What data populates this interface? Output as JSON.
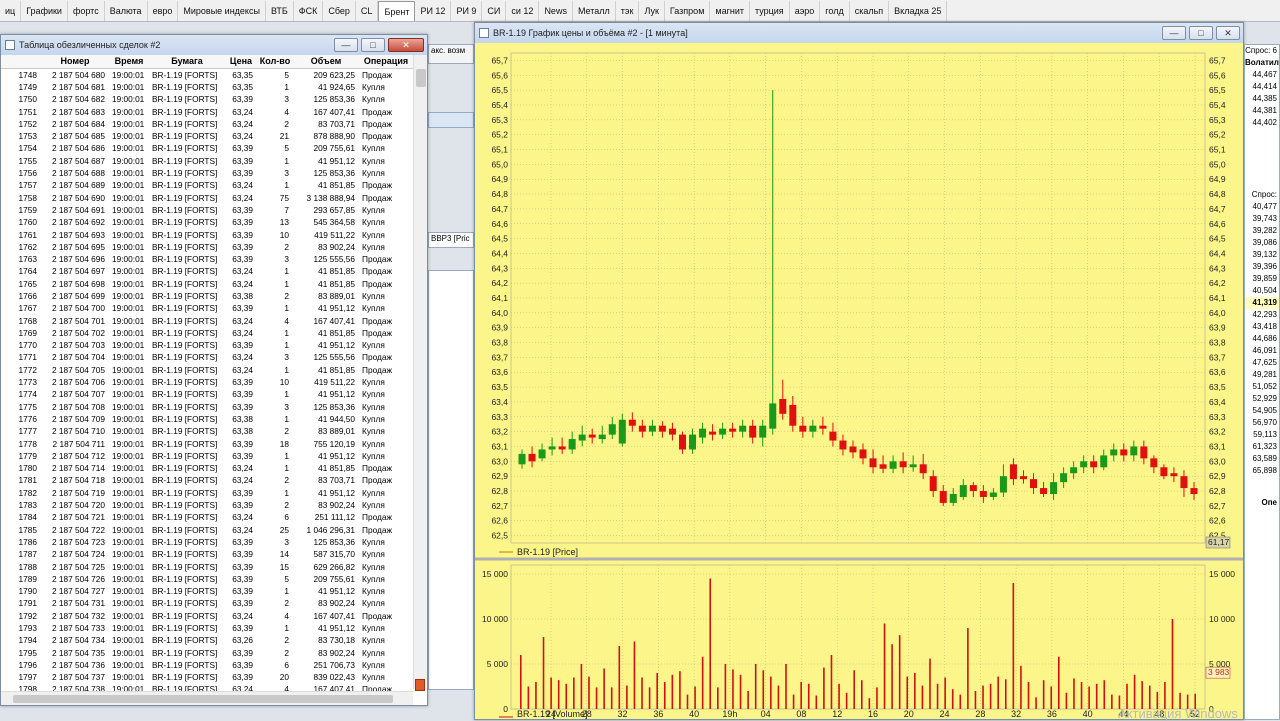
{
  "tabs": [
    "иц",
    "Графики",
    "фортс",
    "Валюта",
    "евро",
    "Мировые индексы",
    "ВТБ",
    "ФСК",
    "Сбер",
    "CL",
    "Брент",
    "РИ 12",
    "РИ 9",
    "СИ",
    "си 12",
    "News",
    "Металл",
    "тэк",
    "Лук",
    "Газпром",
    "магнит",
    "турция",
    "аэро",
    "голд",
    "скальп",
    "Вкладка 25"
  ],
  "active_tab": "Брент",
  "trades_window": {
    "title": "Таблица обезличенных сделок #2",
    "columns": [
      "",
      "Номер",
      "Время",
      "Бумага",
      "Цена",
      "Кол-во",
      "Объем",
      "Операция"
    ],
    "rows": [
      [
        "1748",
        "2 187 504 680",
        "19:00:01",
        "BR-1.19 [FORTS]",
        "63,35",
        "5",
        "209 623,25",
        "Продаж"
      ],
      [
        "1749",
        "2 187 504 681",
        "19:00:01",
        "BR-1.19 [FORTS]",
        "63,35",
        "1",
        "41 924,65",
        "Купля"
      ],
      [
        "1750",
        "2 187 504 682",
        "19:00:01",
        "BR-1.19 [FORTS]",
        "63,39",
        "3",
        "125 853,36",
        "Купля"
      ],
      [
        "1751",
        "2 187 504 683",
        "19:00:01",
        "BR-1.19 [FORTS]",
        "63,24",
        "4",
        "167 407,41",
        "Продаж"
      ],
      [
        "1752",
        "2 187 504 684",
        "19:00:01",
        "BR-1.19 [FORTS]",
        "63,24",
        "2",
        "83 703,71",
        "Продаж"
      ],
      [
        "1753",
        "2 187 504 685",
        "19:00:01",
        "BR-1.19 [FORTS]",
        "63,24",
        "21",
        "878 888,90",
        "Продаж"
      ],
      [
        "1754",
        "2 187 504 686",
        "19:00:01",
        "BR-1.19 [FORTS]",
        "63,39",
        "5",
        "209 755,61",
        "Купля"
      ],
      [
        "1755",
        "2 187 504 687",
        "19:00:01",
        "BR-1.19 [FORTS]",
        "63,39",
        "1",
        "41 951,12",
        "Купля"
      ],
      [
        "1756",
        "2 187 504 688",
        "19:00:01",
        "BR-1.19 [FORTS]",
        "63,39",
        "3",
        "125 853,36",
        "Купля"
      ],
      [
        "1757",
        "2 187 504 689",
        "19:00:01",
        "BR-1.19 [FORTS]",
        "63,24",
        "1",
        "41 851,85",
        "Продаж"
      ],
      [
        "1758",
        "2 187 504 690",
        "19:00:01",
        "BR-1.19 [FORTS]",
        "63,24",
        "75",
        "3 138 888,94",
        "Продаж"
      ],
      [
        "1759",
        "2 187 504 691",
        "19:00:01",
        "BR-1.19 [FORTS]",
        "63,39",
        "7",
        "293 657,85",
        "Купля"
      ],
      [
        "1760",
        "2 187 504 692",
        "19:00:01",
        "BR-1.19 [FORTS]",
        "63,39",
        "13",
        "545 364,58",
        "Купля"
      ],
      [
        "1761",
        "2 187 504 693",
        "19:00:01",
        "BR-1.19 [FORTS]",
        "63,39",
        "10",
        "419 511,22",
        "Купля"
      ],
      [
        "1762",
        "2 187 504 695",
        "19:00:01",
        "BR-1.19 [FORTS]",
        "63,39",
        "2",
        "83 902,24",
        "Купля"
      ],
      [
        "1763",
        "2 187 504 696",
        "19:00:01",
        "BR-1.19 [FORTS]",
        "63,39",
        "3",
        "125 555,56",
        "Продаж"
      ],
      [
        "1764",
        "2 187 504 697",
        "19:00:01",
        "BR-1.19 [FORTS]",
        "63,24",
        "1",
        "41 851,85",
        "Продаж"
      ],
      [
        "1765",
        "2 187 504 698",
        "19:00:01",
        "BR-1.19 [FORTS]",
        "63,24",
        "1",
        "41 851,85",
        "Продаж"
      ],
      [
        "1766",
        "2 187 504 699",
        "19:00:01",
        "BR-1.19 [FORTS]",
        "63,38",
        "2",
        "83 889,01",
        "Купля"
      ],
      [
        "1767",
        "2 187 504 700",
        "19:00:01",
        "BR-1.19 [FORTS]",
        "63,39",
        "1",
        "41 951,12",
        "Купля"
      ],
      [
        "1768",
        "2 187 504 701",
        "19:00:01",
        "BR-1.19 [FORTS]",
        "63,24",
        "4",
        "167 407,41",
        "Продаж"
      ],
      [
        "1769",
        "2 187 504 702",
        "19:00:01",
        "BR-1.19 [FORTS]",
        "63,24",
        "1",
        "41 851,85",
        "Продаж"
      ],
      [
        "1770",
        "2 187 504 703",
        "19:00:01",
        "BR-1.19 [FORTS]",
        "63,39",
        "1",
        "41 951,12",
        "Купля"
      ],
      [
        "1771",
        "2 187 504 704",
        "19:00:01",
        "BR-1.19 [FORTS]",
        "63,24",
        "3",
        "125 555,56",
        "Продаж"
      ],
      [
        "1772",
        "2 187 504 705",
        "19:00:01",
        "BR-1.19 [FORTS]",
        "63,24",
        "1",
        "41 851,85",
        "Продаж"
      ],
      [
        "1773",
        "2 187 504 706",
        "19:00:01",
        "BR-1.19 [FORTS]",
        "63,39",
        "10",
        "419 511,22",
        "Купля"
      ],
      [
        "1774",
        "2 187 504 707",
        "19:00:01",
        "BR-1.19 [FORTS]",
        "63,39",
        "1",
        "41 951,12",
        "Купля"
      ],
      [
        "1775",
        "2 187 504 708",
        "19:00:01",
        "BR-1.19 [FORTS]",
        "63,39",
        "3",
        "125 853,36",
        "Купля"
      ],
      [
        "1776",
        "2 187 504 709",
        "19:00:01",
        "BR-1.19 [FORTS]",
        "63,38",
        "1",
        "41 944,50",
        "Купля"
      ],
      [
        "1777",
        "2 187 504 710",
        "19:00:01",
        "BR-1.19 [FORTS]",
        "63,38",
        "2",
        "83 889,01",
        "Купля"
      ],
      [
        "1778",
        "2 187 504 711",
        "19:00:01",
        "BR-1.19 [FORTS]",
        "63,39",
        "18",
        "755 120,19",
        "Купля"
      ],
      [
        "1779",
        "2 187 504 712",
        "19:00:01",
        "BR-1.19 [FORTS]",
        "63,39",
        "1",
        "41 951,12",
        "Купля"
      ],
      [
        "1780",
        "2 187 504 714",
        "19:00:01",
        "BR-1.19 [FORTS]",
        "63,24",
        "1",
        "41 851,85",
        "Продаж"
      ],
      [
        "1781",
        "2 187 504 718",
        "19:00:01",
        "BR-1.19 [FORTS]",
        "63,24",
        "2",
        "83 703,71",
        "Продаж"
      ],
      [
        "1782",
        "2 187 504 719",
        "19:00:01",
        "BR-1.19 [FORTS]",
        "63,39",
        "1",
        "41 951,12",
        "Купля"
      ],
      [
        "1783",
        "2 187 504 720",
        "19:00:01",
        "BR-1.19 [FORTS]",
        "63,39",
        "2",
        "83 902,24",
        "Купля"
      ],
      [
        "1784",
        "2 187 504 721",
        "19:00:01",
        "BR-1.19 [FORTS]",
        "63,24",
        "6",
        "251 111,12",
        "Продаж"
      ],
      [
        "1785",
        "2 187 504 722",
        "19:00:01",
        "BR-1.19 [FORTS]",
        "63,24",
        "25",
        "1 046 296,31",
        "Продаж"
      ],
      [
        "1786",
        "2 187 504 723",
        "19:00:01",
        "BR-1.19 [FORTS]",
        "63,39",
        "3",
        "125 853,36",
        "Купля"
      ],
      [
        "1787",
        "2 187 504 724",
        "19:00:01",
        "BR-1.19 [FORTS]",
        "63,39",
        "14",
        "587 315,70",
        "Купля"
      ],
      [
        "1788",
        "2 187 504 725",
        "19:00:01",
        "BR-1.19 [FORTS]",
        "63,39",
        "15",
        "629 266,82",
        "Купля"
      ],
      [
        "1789",
        "2 187 504 726",
        "19:00:01",
        "BR-1.19 [FORTS]",
        "63,39",
        "5",
        "209 755,61",
        "Купля"
      ],
      [
        "1790",
        "2 187 504 727",
        "19:00:01",
        "BR-1.19 [FORTS]",
        "63,39",
        "1",
        "41 951,12",
        "Купля"
      ],
      [
        "1791",
        "2 187 504 731",
        "19:00:01",
        "BR-1.19 [FORTS]",
        "63,39",
        "2",
        "83 902,24",
        "Купля"
      ],
      [
        "1792",
        "2 187 504 732",
        "19:00:01",
        "BR-1.19 [FORTS]",
        "63,24",
        "4",
        "167 407,41",
        "Продаж"
      ],
      [
        "1793",
        "2 187 504 733",
        "19:00:01",
        "BR-1.19 [FORTS]",
        "63,39",
        "1",
        "41 951,12",
        "Купля"
      ],
      [
        "1794",
        "2 187 504 734",
        "19:00:01",
        "BR-1.19 [FORTS]",
        "63,26",
        "2",
        "83 730,18",
        "Купля"
      ],
      [
        "1795",
        "2 187 504 735",
        "19:00:01",
        "BR-1.19 [FORTS]",
        "63,39",
        "2",
        "83 902,24",
        "Купля"
      ],
      [
        "1796",
        "2 187 504 736",
        "19:00:01",
        "BR-1.19 [FORTS]",
        "63,39",
        "6",
        "251 706,73",
        "Купля"
      ],
      [
        "1797",
        "2 187 504 737",
        "19:00:01",
        "BR-1.19 [FORTS]",
        "63,39",
        "20",
        "839 022,43",
        "Купля"
      ],
      [
        "1798",
        "2 187 504 738",
        "19:00:01",
        "BR-1.19 [FORTS]",
        "63,24",
        "4",
        "167 407,41",
        "Продаж"
      ]
    ]
  },
  "chart_window": {
    "title": "BR-1.19 График цены и объёма #2 - [1 минута]",
    "price_legend": "BR-1.19 [Price]",
    "volume_legend": "BR-1.19 [Volume]",
    "last_price_label": "61,17",
    "last_volume_label": "3 983",
    "x_ticks": [
      "24",
      "28",
      "32",
      "36",
      "40",
      "19h",
      "04",
      "08",
      "12",
      "16",
      "20",
      "24",
      "28",
      "32",
      "36",
      "40",
      "44",
      "48",
      "52"
    ]
  },
  "chart_data": [
    {
      "type": "candlestick",
      "series_name": "BR-1.19 [Price]",
      "ylim": [
        62.45,
        65.75
      ],
      "y_ticks": [
        "62,5",
        "62,6",
        "62,7",
        "62,8",
        "62,9",
        "63,0",
        "63,1",
        "63,2",
        "63,3",
        "63,4",
        "63,5",
        "63,6",
        "63,7",
        "63,8",
        "63,9",
        "64,0",
        "64,1",
        "64,2",
        "64,3",
        "64,4",
        "64,5",
        "64,6",
        "64,7",
        "64,8",
        "64,9",
        "65,0",
        "65,1",
        "65,2",
        "65,3",
        "65,4",
        "65,5",
        "65,6",
        "65,7"
      ],
      "candles": [
        [
          62.98,
          63.05,
          62.95,
          63.08
        ],
        [
          63.05,
          63.0,
          62.96,
          63.1
        ],
        [
          63.02,
          63.08,
          63.0,
          63.12
        ],
        [
          63.08,
          63.1,
          63.04,
          63.16
        ],
        [
          63.1,
          63.08,
          63.05,
          63.16
        ],
        [
          63.08,
          63.15,
          63.05,
          63.2
        ],
        [
          63.14,
          63.18,
          63.1,
          63.24
        ],
        [
          63.18,
          63.16,
          63.12,
          63.22
        ],
        [
          63.15,
          63.18,
          63.12,
          63.24
        ],
        [
          63.18,
          63.25,
          63.15,
          63.3
        ],
        [
          63.12,
          63.28,
          63.1,
          63.32
        ],
        [
          63.28,
          63.24,
          63.2,
          63.33
        ],
        [
          63.24,
          63.2,
          63.16,
          63.28
        ],
        [
          63.2,
          63.24,
          63.17,
          63.28
        ],
        [
          63.24,
          63.2,
          63.16,
          63.27
        ],
        [
          63.22,
          63.18,
          63.14,
          63.26
        ],
        [
          63.18,
          63.08,
          63.05,
          63.2
        ],
        [
          63.08,
          63.18,
          63.05,
          63.22
        ],
        [
          63.16,
          63.22,
          63.12,
          63.26
        ],
        [
          63.2,
          63.18,
          63.14,
          63.25
        ],
        [
          63.18,
          63.22,
          63.15,
          63.26
        ],
        [
          63.22,
          63.2,
          63.16,
          63.26
        ],
        [
          63.2,
          63.24,
          63.16,
          63.28
        ],
        [
          63.24,
          63.16,
          63.12,
          63.28
        ],
        [
          63.16,
          63.24,
          63.1,
          63.28
        ],
        [
          63.22,
          63.39,
          63.18,
          65.5
        ],
        [
          63.42,
          63.32,
          63.28,
          63.55
        ],
        [
          63.38,
          63.24,
          63.2,
          63.44
        ],
        [
          63.24,
          63.2,
          63.16,
          63.3
        ],
        [
          63.2,
          63.24,
          63.16,
          63.28
        ],
        [
          63.24,
          63.22,
          63.18,
          63.3
        ],
        [
          63.2,
          63.14,
          63.1,
          63.26
        ],
        [
          63.14,
          63.08,
          63.04,
          63.18
        ],
        [
          63.1,
          63.06,
          63.02,
          63.14
        ],
        [
          63.08,
          63.02,
          62.98,
          63.12
        ],
        [
          63.02,
          62.96,
          62.92,
          63.08
        ],
        [
          62.98,
          62.95,
          62.92,
          63.04
        ],
        [
          62.95,
          63.0,
          62.92,
          63.04
        ],
        [
          63.0,
          62.96,
          62.92,
          63.06
        ],
        [
          62.96,
          62.98,
          62.93,
          63.04
        ],
        [
          62.98,
          62.92,
          62.88,
          63.05
        ],
        [
          62.9,
          62.8,
          62.76,
          62.94
        ],
        [
          62.8,
          62.72,
          62.7,
          62.84
        ],
        [
          62.72,
          62.78,
          62.7,
          62.82
        ],
        [
          62.76,
          62.84,
          62.74,
          62.88
        ],
        [
          62.84,
          62.8,
          62.76,
          62.86
        ],
        [
          62.8,
          62.76,
          62.72,
          62.84
        ],
        [
          62.76,
          62.79,
          62.74,
          62.82
        ],
        [
          62.79,
          62.9,
          62.76,
          62.98
        ],
        [
          62.98,
          62.88,
          62.84,
          63.02
        ],
        [
          62.9,
          62.88,
          62.85,
          62.94
        ],
        [
          62.88,
          62.82,
          62.78,
          62.92
        ],
        [
          62.82,
          62.78,
          62.76,
          62.86
        ],
        [
          62.78,
          62.86,
          62.74,
          62.92
        ],
        [
          62.86,
          62.92,
          62.82,
          62.96
        ],
        [
          62.92,
          62.96,
          62.88,
          63.0
        ],
        [
          62.96,
          63.0,
          62.92,
          63.04
        ],
        [
          63.0,
          62.96,
          62.92,
          63.04
        ],
        [
          62.96,
          63.04,
          62.94,
          63.08
        ],
        [
          63.04,
          63.08,
          63.0,
          63.12
        ],
        [
          63.08,
          63.04,
          63.0,
          63.12
        ],
        [
          63.04,
          63.1,
          63.0,
          63.14
        ],
        [
          63.1,
          63.02,
          62.98,
          63.14
        ],
        [
          63.02,
          62.96,
          62.92,
          63.04
        ],
        [
          62.96,
          62.9,
          62.88,
          62.98
        ],
        [
          62.92,
          62.9,
          62.86,
          62.96
        ],
        [
          62.9,
          62.82,
          62.76,
          62.94
        ],
        [
          62.82,
          62.78,
          62.74,
          62.86
        ]
      ]
    },
    {
      "type": "bar",
      "series_name": "BR-1.19 [Volume]",
      "ylim": [
        0,
        16000
      ],
      "y_ticks": [
        "0",
        "5 000",
        "10 000",
        "15 000"
      ],
      "values": [
        6000,
        2500,
        3000,
        8000,
        3500,
        3200,
        2800,
        3500,
        5000,
        3600,
        2400,
        4500,
        2400,
        7000,
        2600,
        7500,
        3500,
        2400,
        4000,
        3000,
        3800,
        4200,
        1600,
        2500,
        5800,
        14500,
        2400,
        5000,
        4400,
        3800,
        2000,
        5000,
        4300,
        3600,
        2600,
        5000,
        1600,
        3000,
        2800,
        1500,
        4600,
        6000,
        2800,
        1800,
        4300,
        3200,
        1200,
        2400,
        9500,
        7200,
        8200,
        3600,
        4000,
        2600,
        5600,
        2800,
        3500,
        2200,
        1600,
        9000,
        2000,
        2600,
        2800,
        3600,
        3300,
        14000,
        4800,
        3000,
        1300,
        3200,
        2500,
        5800,
        1800,
        3400,
        3000,
        2500,
        2800,
        3200,
        1600,
        1500,
        2800,
        3800,
        3100,
        2600,
        1900,
        3000,
        10000,
        1800,
        1600,
        1700
      ]
    }
  ],
  "right_panel": {
    "header": "Спрос: 6",
    "volat_label": "Волатил",
    "values_top": [
      "44,467",
      "44,414",
      "44,385",
      "44,381",
      "44,402"
    ],
    "label2": "Спрос:",
    "values": [
      "40,477",
      "39,743",
      "39,282",
      "39,086",
      "39,132",
      "39,396",
      "39,859",
      "40,504",
      "41,319",
      "42,293",
      "43,418",
      "44,686",
      "46,091",
      "47,625",
      "49,281",
      "51,052",
      "52,929",
      "54,905",
      "56,970",
      "59,113",
      "61,323",
      "63,589",
      "65,898"
    ],
    "bottom_label": "Опе"
  },
  "watermark": "Активация Windows"
}
